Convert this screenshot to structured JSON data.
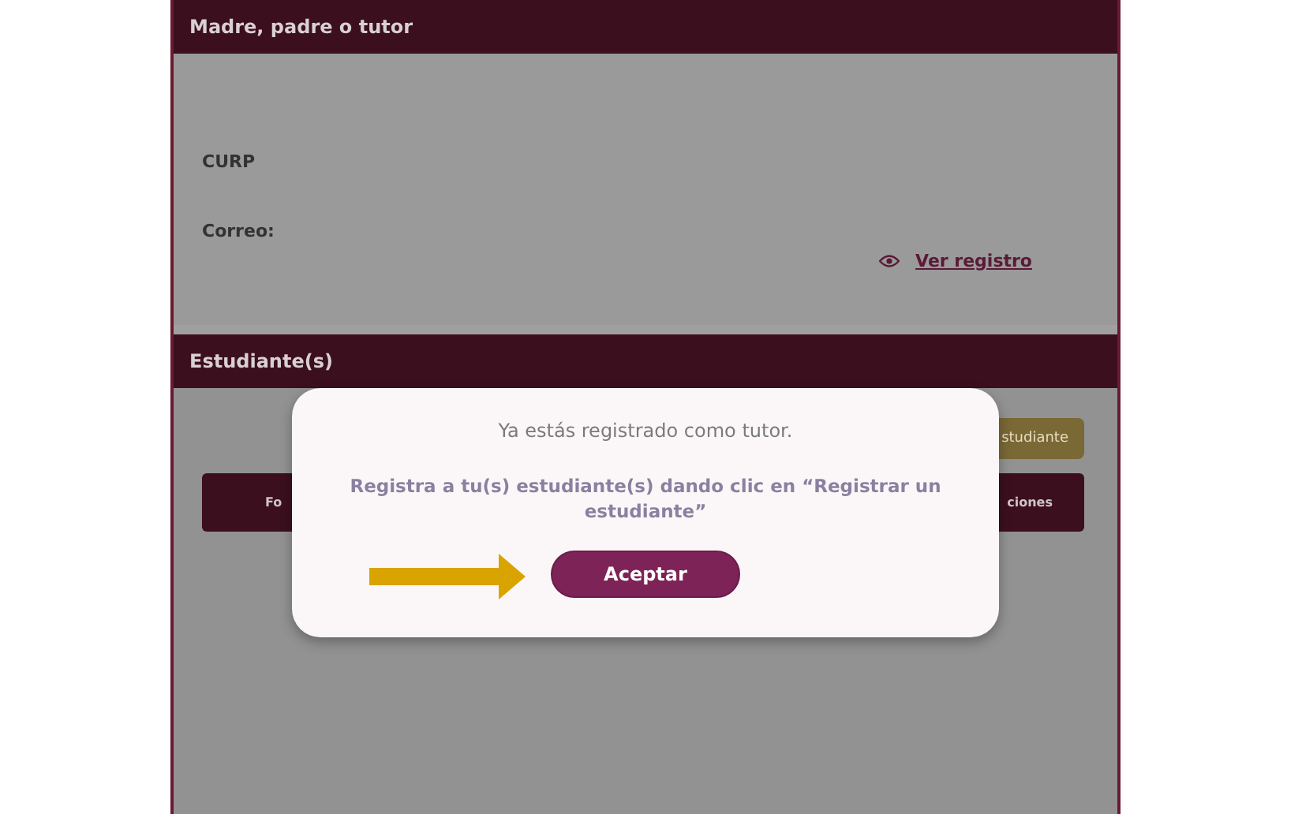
{
  "tutor_section": {
    "title": "Madre, padre o tutor",
    "fields": [
      {
        "label": "CURP"
      },
      {
        "label": "Correo:"
      }
    ],
    "view_link": "Ver registro"
  },
  "students_section": {
    "title": "Estudiante(s)",
    "register_button": "studiante",
    "table_header": [
      "Fo",
      "ciones"
    ]
  },
  "dialog": {
    "message": "Ya estás registrado como tutor.",
    "instruction": "Registra a tu(s) estudiante(s) dando clic en “Registrar un estudiante”",
    "button": "Aceptar"
  }
}
